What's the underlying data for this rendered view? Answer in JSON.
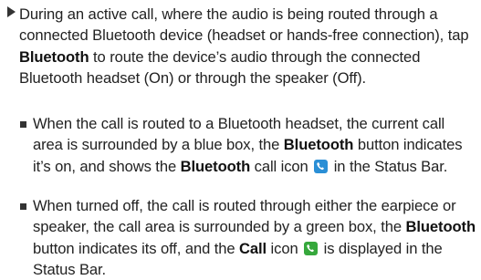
{
  "bullet1": {
    "text_a": "During an active call, where the audio is being routed through a connected Bluetooth device (headset or hands-free connection), tap ",
    "bold_a": "Bluetooth",
    "text_b": " to route the device’s audio through the connected Bluetooth headset (On) or through the speaker (Off)."
  },
  "sub1": {
    "text_a": "When the call is routed to a Bluetooth headset, the current call area is surrounded by a blue box, the ",
    "bold_a": "Bluetooth",
    "text_b": " button indicates it’s on, and shows the ",
    "bold_b": "Bluetooth",
    "text_c": " call icon ",
    "icon": "bluetooth-call-icon",
    "text_d": " in the Status Bar."
  },
  "sub2": {
    "text_a": "When turned off, the call is routed through either the earpiece or speaker, the call area is surrounded by a green box, the ",
    "bold_a": "Bluetooth",
    "text_b": " button indicates its off, and the ",
    "bold_b": "Call",
    "text_c": " icon ",
    "icon": "call-icon",
    "text_d": " is displayed in the Status Bar."
  },
  "colors": {
    "bluetooth_icon": "#2a8fd6",
    "call_icon": "#36a83c",
    "text": "#222222"
  }
}
